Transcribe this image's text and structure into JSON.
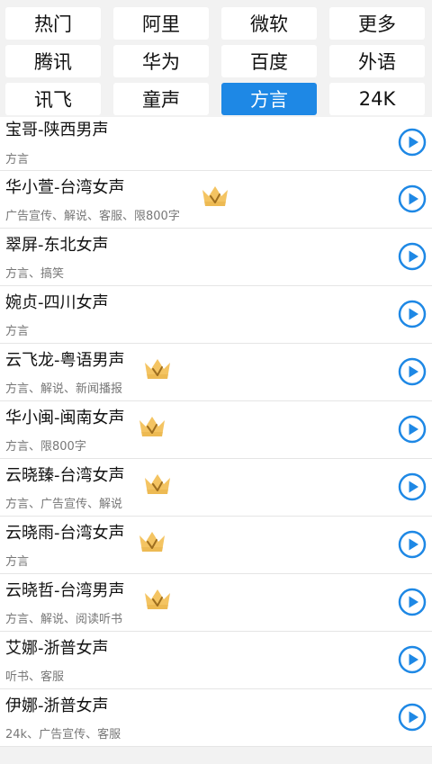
{
  "tabs": [
    {
      "label": "热门",
      "active": false
    },
    {
      "label": "阿里",
      "active": false
    },
    {
      "label": "微软",
      "active": false
    },
    {
      "label": "更多",
      "active": false
    },
    {
      "label": "腾讯",
      "active": false
    },
    {
      "label": "华为",
      "active": false
    },
    {
      "label": "百度",
      "active": false
    },
    {
      "label": "外语",
      "active": false
    },
    {
      "label": "讯飞",
      "active": false
    },
    {
      "label": "童声",
      "active": false
    },
    {
      "label": "方言",
      "active": true
    },
    {
      "label": "24K",
      "active": false
    }
  ],
  "voices": [
    {
      "name": "宝哥-陕西男声",
      "desc": "方言",
      "vip": false
    },
    {
      "name": "华小萱-台湾女声",
      "desc": "广告宣传、解说、客服、限800字",
      "vip": true
    },
    {
      "name": "翠屏-东北女声",
      "desc": "方言、搞笑",
      "vip": false
    },
    {
      "name": "婉贞-四川女声",
      "desc": "方言",
      "vip": false
    },
    {
      "name": "云飞龙-粤语男声",
      "desc": "方言、解说、新闻播报",
      "vip": true
    },
    {
      "name": "华小闽-闽南女声",
      "desc": "方言、限800字",
      "vip": true
    },
    {
      "name": "云晓臻-台湾女声",
      "desc": "方言、广告宣传、解说",
      "vip": true
    },
    {
      "name": "云晓雨-台湾女声",
      "desc": "方言",
      "vip": true
    },
    {
      "name": "云晓哲-台湾男声",
      "desc": "方言、解说、阅读听书",
      "vip": true
    },
    {
      "name": "艾娜-浙普女声",
      "desc": "听书、客服",
      "vip": false
    },
    {
      "name": "伊娜-浙普女声",
      "desc": "24k、广告宣传、客服",
      "vip": false
    }
  ],
  "colors": {
    "accent": "#1e88e5",
    "crown": "#f4c462",
    "crown_dark": "#e0a93a",
    "play": "#1e88e5"
  },
  "icons": {
    "vip": "crown-icon",
    "play": "play-circle-icon"
  }
}
